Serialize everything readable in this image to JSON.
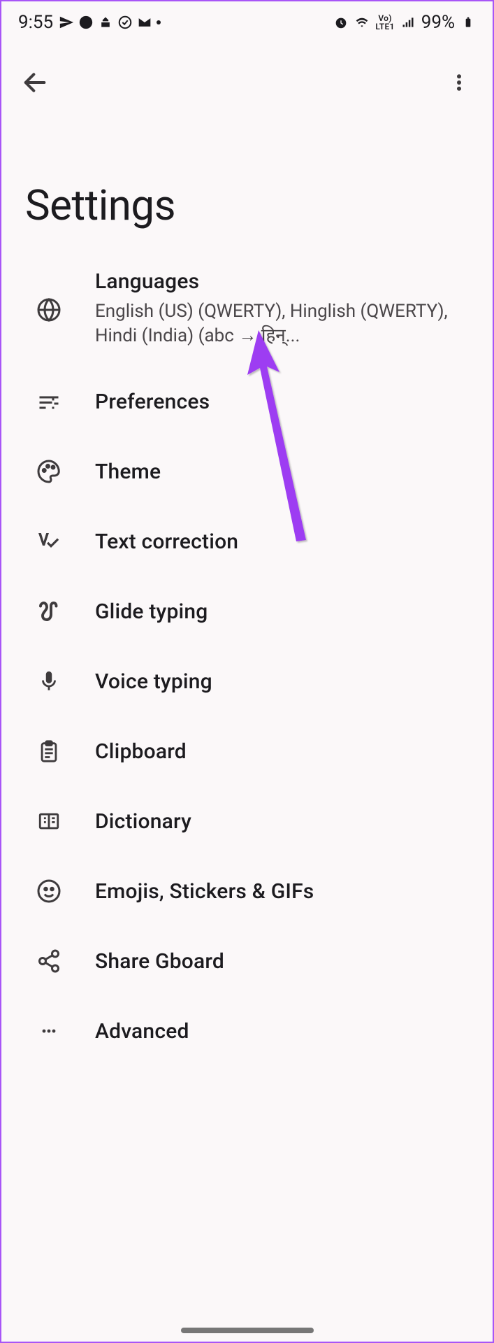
{
  "status": {
    "time": "9:55",
    "battery_percent": "99%",
    "lte_label_top": "Vo)",
    "lte_label_bot": "LTE1"
  },
  "header": {
    "title": "Settings"
  },
  "items": [
    {
      "title": "Languages",
      "subtitle": "English (US) (QWERTY), Hinglish (QWERTY), Hindi (India) (abc → हिन्..."
    },
    {
      "title": "Preferences"
    },
    {
      "title": "Theme"
    },
    {
      "title": "Text correction"
    },
    {
      "title": "Glide typing"
    },
    {
      "title": "Voice typing"
    },
    {
      "title": "Clipboard"
    },
    {
      "title": "Dictionary"
    },
    {
      "title": "Emojis, Stickers & GIFs"
    },
    {
      "title": "Share Gboard"
    },
    {
      "title": "Advanced"
    }
  ]
}
